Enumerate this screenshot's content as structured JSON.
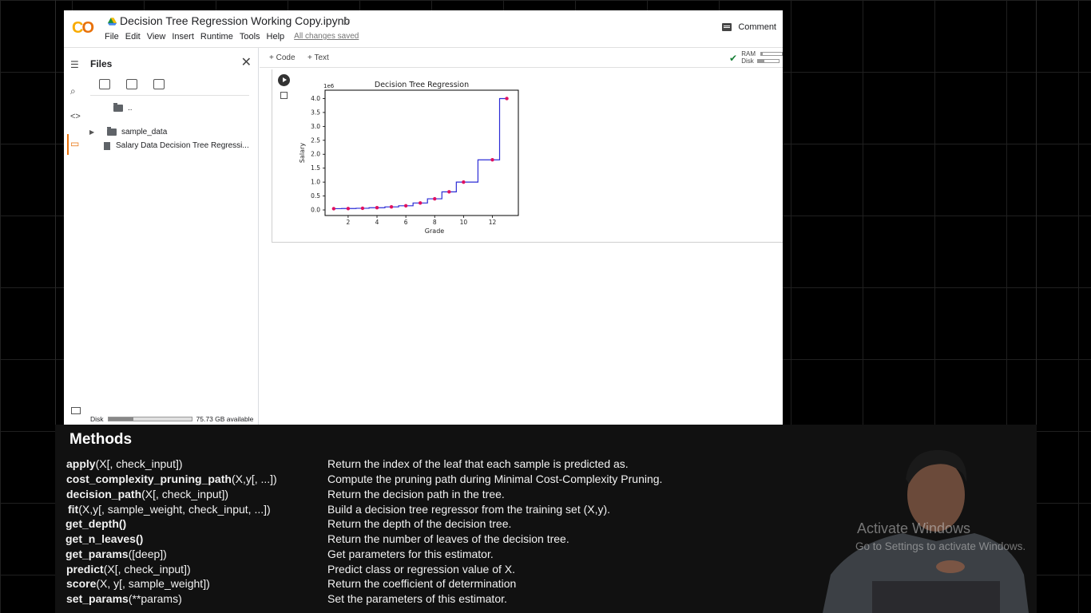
{
  "colab": {
    "notebook_title": "Decision Tree Regression Working Copy.ipynb",
    "menu": [
      "File",
      "Edit",
      "View",
      "Insert",
      "Runtime",
      "Tools",
      "Help"
    ],
    "saved_status": "All changes saved",
    "comment_label": "Comment",
    "toolbar": {
      "code_label": "+ Code",
      "text_label": "+ Text",
      "ram_label": "RAM",
      "disk_label": "Disk"
    },
    "files_panel": {
      "title": "Files",
      "items": [
        {
          "name": "..",
          "kind": "parent"
        },
        {
          "name": "sample_data",
          "kind": "folder"
        },
        {
          "name": "Salary Data Decision Tree Regressi...",
          "kind": "file"
        }
      ],
      "disk_label": "Disk",
      "disk_available": "75.73 GB available",
      "disk_used_fraction": 0.3
    }
  },
  "chart_data": {
    "type": "line",
    "title": "Decision Tree Regression",
    "xlabel": "Grade",
    "ylabel": "Salary",
    "y_offset_label": "1e6",
    "xlim": [
      0.4,
      13.8
    ],
    "ylim": [
      -0.2,
      4.3
    ],
    "xticks": [
      2,
      4,
      6,
      8,
      10,
      12
    ],
    "yticks": [
      "0.0",
      "0.5",
      "1.0",
      "1.5",
      "2.0",
      "2.5",
      "3.0",
      "3.5",
      "4.0"
    ],
    "points_x": [
      1,
      2,
      3,
      4,
      5,
      6,
      7,
      8,
      9,
      10,
      12,
      13
    ],
    "points_y": [
      0.045,
      0.05,
      0.06,
      0.08,
      0.11,
      0.15,
      0.25,
      0.4,
      0.65,
      1.0,
      1.8,
      4.0
    ],
    "step_x": [
      0.9,
      1.55,
      2.55,
      3.45,
      4.55,
      5.5,
      6.5,
      7.5,
      8.5,
      9.5,
      11.0,
      12.5,
      13.1
    ],
    "step_y": [
      0.045,
      0.05,
      0.06,
      0.08,
      0.11,
      0.15,
      0.25,
      0.4,
      0.65,
      1.0,
      1.8,
      4.0
    ],
    "line_color": "#2c2cd6",
    "point_color": "#e0115f",
    "grid": false
  },
  "methods": {
    "title": "Methods",
    "rows": [
      {
        "name": "apply",
        "args": "(X[, check_input])",
        "desc": "Return the index of the leaf that each sample is predicted as."
      },
      {
        "name": "cost_complexity_pruning_path",
        "args": "(X,y[, ...])",
        "desc": "Compute the pruning path during Minimal Cost-Complexity Pruning."
      },
      {
        "name": "decision_path",
        "args": "(X[, check_input])",
        "desc": "Return the decision path in the tree."
      },
      {
        "name": "fit",
        "args": "(X,y[, sample_weight, check_input, ...])",
        "desc": "Build a decision tree regressor from the training set (X,y)."
      },
      {
        "name": "get_depth()",
        "args": "",
        "desc": "Return the depth of the decision tree."
      },
      {
        "name": "get_n_leaves()",
        "args": "",
        "desc": "Return the number of leaves of the decision tree."
      },
      {
        "name": "get_params",
        "args": "([deep])",
        "desc": "Get parameters for this estimator."
      },
      {
        "name": "predict",
        "args": "(X[, check_input])",
        "desc": "Predict class or regression value of X."
      },
      {
        "name": "score",
        "args": "(X, y[, sample_weight])",
        "desc": "Return the coefficient of determination"
      },
      {
        "name": "set_params",
        "args": "(**params)",
        "desc": "Set the parameters of this estimator."
      }
    ]
  },
  "watermark": {
    "line1": "Activate Windows",
    "line2": "Go to Settings to activate Windows."
  }
}
